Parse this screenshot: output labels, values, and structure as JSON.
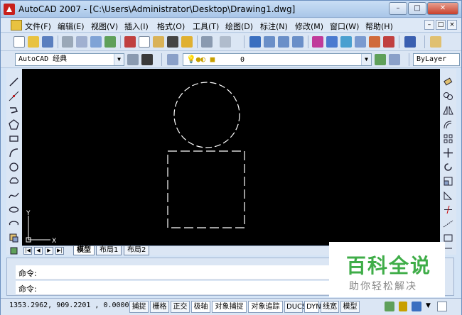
{
  "window": {
    "title": "AutoCAD 2007 - [C:\\Users\\Administrator\\Desktop\\Drawing1.dwg]",
    "min_label": "–",
    "max_label": "□",
    "close_label": "✕"
  },
  "menu": {
    "items": [
      "文件(F)",
      "编辑(E)",
      "视图(V)",
      "插入(I)",
      "格式(O)",
      "工具(T)",
      "绘图(D)",
      "标注(N)",
      "修改(M)",
      "窗口(W)",
      "帮助(H)"
    ],
    "mdi_min": "–",
    "mdi_max": "□",
    "mdi_close": "×"
  },
  "toolbar": {
    "workspace": "AutoCAD 经典",
    "layer_value": "0",
    "linetype": "ByLayer"
  },
  "canvas": {
    "background": "#000000",
    "ucs_x": "X",
    "ucs_y": "Y"
  },
  "layout_tabs": [
    "模型",
    "布局1",
    "布局2"
  ],
  "command": {
    "line1": "命令:",
    "line2": "命令:"
  },
  "status": {
    "coords": "1353.2962, 909.2201 , 0.0000",
    "buttons": [
      "捕捉",
      "栅格",
      "正交",
      "极轴",
      "对象捕捉",
      "对象追踪",
      "DUCS",
      "DYN",
      "线宽",
      "模型"
    ]
  },
  "watermark": {
    "main": "百科全说",
    "sub": "助你轻松解决"
  },
  "colors": {
    "accent_green": "#3fad48",
    "canvas": "#000000"
  }
}
